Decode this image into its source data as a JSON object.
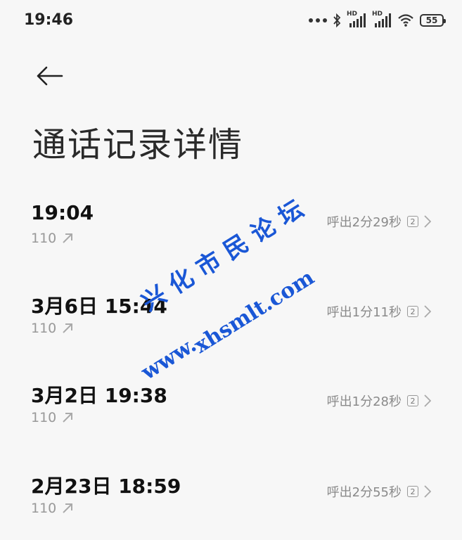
{
  "status_bar": {
    "time": "19:46",
    "hd_label": "HD",
    "battery": "55",
    "icons": [
      "more-dots-icon",
      "bluetooth-icon",
      "signal-hd-icon",
      "signal-hd-icon",
      "wifi-icon",
      "battery-icon"
    ]
  },
  "header": {
    "back_icon": "back-arrow-icon",
    "title": "通话记录详情"
  },
  "calls": [
    {
      "time": "19:04",
      "number": "110",
      "direction_icon": "outgoing-arrow-icon",
      "detail": "呼出2分29秒",
      "sim": "2"
    },
    {
      "time": "3月6日 15:44",
      "number": "110",
      "direction_icon": "outgoing-arrow-icon",
      "detail": "呼出1分11秒",
      "sim": "2"
    },
    {
      "time": "3月2日 19:38",
      "number": "110",
      "direction_icon": "outgoing-arrow-icon",
      "detail": "呼出1分28秒",
      "sim": "2"
    },
    {
      "time": "2月23日 18:59",
      "number": "110",
      "direction_icon": "outgoing-arrow-icon",
      "detail": "呼出2分55秒",
      "sim": "2"
    }
  ],
  "watermark": {
    "line1": "兴 化 市 民 论 坛",
    "line2": "xhsmlt.com",
    "line3": "www.",
    "color": "#1a57d6"
  }
}
